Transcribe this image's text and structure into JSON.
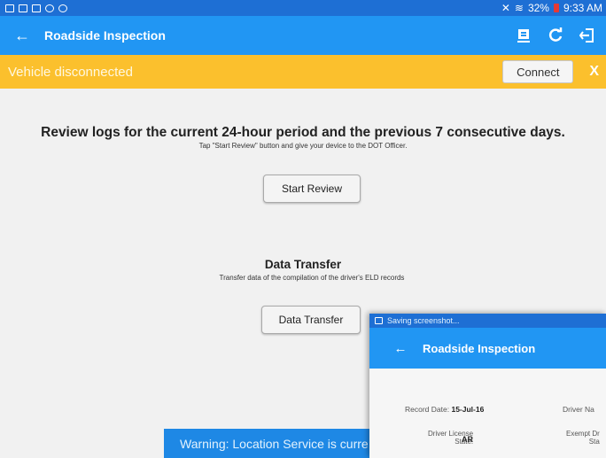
{
  "status_bar": {
    "battery": "32%",
    "time": "9:33 AM"
  },
  "app_bar": {
    "back_icon": "←",
    "title": "Roadside Inspection"
  },
  "banner": {
    "text": "Vehicle disconnected",
    "connect_label": "Connect",
    "close_label": "X"
  },
  "review": {
    "heading": "Review logs for the current 24-hour period and the previous 7 consecutive days.",
    "subtext": "Tap \"Start Review\" button and give your device to the DOT Officer.",
    "button_label": "Start Review"
  },
  "data_transfer": {
    "heading": "Data Transfer",
    "subtext": "Transfer data of the compilation of the driver's ELD records",
    "button_label": "Data Transfer"
  },
  "toast": {
    "text": "Warning: Location Service is curre"
  },
  "overlay": {
    "status_text": "Saving screenshot...",
    "back_icon": "←",
    "title": "Roadside Inspection",
    "record_date_label": "Record Date:",
    "record_date_value": "15-Jul-16",
    "driver_name_label": "Driver Na",
    "license_label_1": "Driver License",
    "license_label_2": "State:",
    "license_value": "AR",
    "exempt_label_1": "Exempt Dr",
    "exempt_label_2": "Sta"
  },
  "colors": {
    "status_bar": "#1e6fd4",
    "app_bar": "#2196f3",
    "banner": "#fbc02d",
    "toast": "#1e88e5",
    "background": "#f1f1f1"
  }
}
